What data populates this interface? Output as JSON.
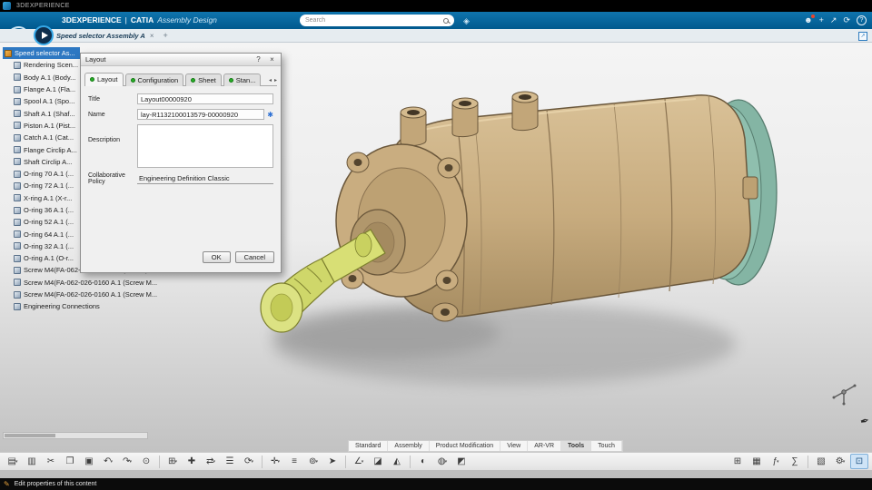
{
  "os_bar": {
    "title": "3DEXPERIENCE"
  },
  "header": {
    "brand": "3DEXPERIENCE",
    "divider": "|",
    "app": "CATIA",
    "module": "Assembly Design",
    "search": {
      "placeholder": "Search"
    },
    "icons": {
      "avatar": "☻",
      "add": "+",
      "share": "↗",
      "history": "⟳",
      "help": "?"
    }
  },
  "tab_bar": {
    "active_tab": "Speed selector Assembly A",
    "close": "×",
    "new_tab": "+",
    "expand": "↗"
  },
  "tree": {
    "items": [
      {
        "label": "Speed selector As...",
        "cls": "selected root",
        "name": "tree-item-root-product"
      },
      {
        "label": "Rendering Scen..."
      },
      {
        "label": "Body A.1 (Body..."
      },
      {
        "label": "Flange A.1 (Fla..."
      },
      {
        "label": "Spool A.1 (Spo..."
      },
      {
        "label": "Shaft A.1 (Shaf..."
      },
      {
        "label": "Piston A.1 (Pist..."
      },
      {
        "label": "Catch A.1 (Cat..."
      },
      {
        "label": "Flange Circlip A..."
      },
      {
        "label": "Shaft Circlip A..."
      },
      {
        "label": "O-ring 70 A.1 (..."
      },
      {
        "label": "O-ring 72 A.1 (..."
      },
      {
        "label": "X-ring A.1 (X-r..."
      },
      {
        "label": "O-ring 36 A.1 (..."
      },
      {
        "label": "O-ring 52 A.1 (..."
      },
      {
        "label": "O-ring 64 A.1 (..."
      },
      {
        "label": "O-ring 32 A.1 (..."
      },
      {
        "label": "O-ring A.1 (O-r..."
      },
      {
        "label": "Screw M4(FA-062-026-0160 A.1 (DEMO)..."
      },
      {
        "label": "Screw M4(FA-062-026-0160 A.1 (Screw M..."
      },
      {
        "label": "Screw M4(FA-062-026-0160 A.1 (Screw M..."
      },
      {
        "label": "Engineering Connections",
        "name": "tree-item-engineering-connections"
      }
    ]
  },
  "dialog": {
    "title": "Layout",
    "help": "?",
    "close": "×",
    "tabs": [
      {
        "label": "Layout",
        "cls": "active",
        "name": "dialog-tab-layout"
      },
      {
        "label": "Configuration",
        "name": "dialog-tab-configuration"
      },
      {
        "label": "Sheet",
        "name": "dialog-tab-sheet"
      },
      {
        "label": "Stan...",
        "name": "dialog-tab-standard"
      }
    ],
    "tab_scroll": {
      "left": "◂",
      "right": "▸"
    },
    "fields": {
      "title": {
        "label": "Title",
        "value": "Layout00000920"
      },
      "name": {
        "label": "Name",
        "value": "lay-R1132100013579-00000920",
        "required_marker": "✱"
      },
      "description": {
        "label": "Description",
        "value": ""
      },
      "policy": {
        "label": "Collaborative Policy",
        "value": "Engineering Definition Classic"
      }
    },
    "buttons": {
      "ok": "OK",
      "cancel": "Cancel"
    }
  },
  "ribbon": {
    "tabs": [
      {
        "label": "Standard",
        "name": "ribbon-tab-standard"
      },
      {
        "label": "Assembly",
        "name": "ribbon-tab-assembly"
      },
      {
        "label": "Product Modification",
        "name": "ribbon-tab-product-modification"
      },
      {
        "label": "View",
        "name": "ribbon-tab-view"
      },
      {
        "label": "AR-VR",
        "name": "ribbon-tab-ar-vr"
      },
      {
        "label": "Tools",
        "cls": "active",
        "name": "ribbon-tab-tools"
      },
      {
        "label": "Touch",
        "name": "ribbon-tab-touch"
      }
    ]
  },
  "toolbar": {
    "items": [
      {
        "name": "clipboard-paste-icon",
        "glyph": "▤",
        "caret": "▾"
      },
      {
        "name": "print-icon",
        "glyph": "▥"
      },
      {
        "name": "cut-icon",
        "glyph": "✂"
      },
      {
        "name": "copy-icon",
        "glyph": "❐"
      },
      {
        "name": "paste-icon",
        "glyph": "▣"
      },
      {
        "name": "undo-icon",
        "glyph": "↶",
        "caret": "▾"
      },
      {
        "name": "redo-icon",
        "glyph": "↷",
        "caret": "▾"
      },
      {
        "name": "search-icon",
        "glyph": "⊙"
      },
      {
        "name": "toolbar-separator",
        "cls": "sep"
      },
      {
        "name": "insert-component-icon",
        "glyph": "⊞",
        "caret": "▾"
      },
      {
        "name": "new-content-icon",
        "glyph": "✚"
      },
      {
        "name": "replace-component-icon",
        "glyph": "⇄",
        "caret": "▾"
      },
      {
        "name": "product-structure-icon",
        "glyph": "☰"
      },
      {
        "name": "update-icon",
        "glyph": "⟳",
        "caret": "▾"
      },
      {
        "name": "toolbar-separator",
        "cls": "sep"
      },
      {
        "name": "move-icon",
        "glyph": "✛",
        "caret": "▾"
      },
      {
        "name": "align-icon",
        "glyph": "≡"
      },
      {
        "name": "engineering-connection-icon",
        "glyph": "⊚",
        "caret": "▾"
      },
      {
        "name": "manipulate-icon",
        "glyph": "➤"
      },
      {
        "name": "toolbar-separator",
        "cls": "sep"
      },
      {
        "name": "measure-icon",
        "glyph": "∠",
        "caret": "▾"
      },
      {
        "name": "section-icon",
        "glyph": "◪"
      },
      {
        "name": "clash-icon",
        "glyph": "◭"
      },
      {
        "name": "toolbar-separator",
        "cls": "sep"
      },
      {
        "name": "hide-show-icon",
        "glyph": "◐"
      },
      {
        "name": "visualization-icon",
        "glyph": "◍",
        "caret": "▾"
      },
      {
        "name": "render-style-icon",
        "glyph": "◩"
      },
      {
        "name": "toolbar-spacer",
        "cls": "spacer"
      },
      {
        "name": "design-table-icon",
        "glyph": "⊞"
      },
      {
        "name": "spreadsheet-icon",
        "glyph": "▦"
      },
      {
        "name": "formula-icon",
        "glyph": "ƒ",
        "caret": "▾"
      },
      {
        "name": "rules-icon",
        "glyph": "∑"
      },
      {
        "name": "toolbar-separator",
        "cls": "sep"
      },
      {
        "name": "catalog-icon",
        "glyph": "▧"
      },
      {
        "name": "options-icon",
        "glyph": "⚙",
        "caret": "▾"
      },
      {
        "name": "touch-mode-icon",
        "glyph": "⊡",
        "cls": "active"
      }
    ]
  },
  "status_bar": {
    "icon": "✎",
    "text": "Edit properties of this content"
  }
}
